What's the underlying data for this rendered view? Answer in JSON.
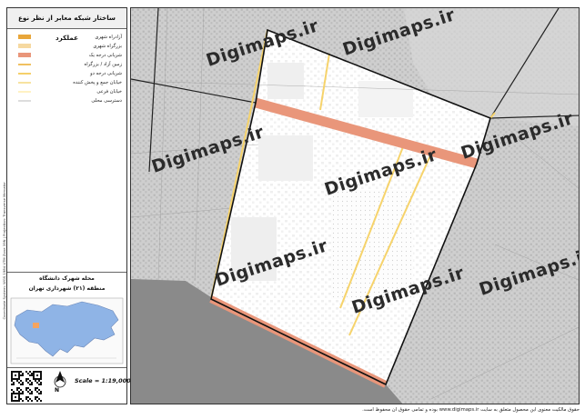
{
  "panel": {
    "title": "ساختار شبکه معابر از نظر نوع عملکرد",
    "legend": [
      {
        "label": "آزادراه شهری",
        "color": "#e8a63a",
        "kind": "fill"
      },
      {
        "label": "بزرگراه شهری",
        "color": "#f6d9a0",
        "kind": "fill"
      },
      {
        "label": "شریانی درجه یک",
        "color": "#e9967a",
        "kind": "thick"
      },
      {
        "label": "زمین آزاد / بزرگراه",
        "color": "#f0c060",
        "kind": "line"
      },
      {
        "label": "شریانی درجه دو",
        "color": "#f5d06a",
        "kind": "line"
      },
      {
        "label": "خیابان جمع و پخش کننده",
        "color": "#f7e3a0",
        "kind": "line"
      },
      {
        "label": "خیابان فرعی",
        "color": "#fff2c4",
        "kind": "line"
      },
      {
        "label": "دسترسی محلی",
        "color": "#dddddd",
        "kind": "line"
      }
    ],
    "location_title": "محله شهرک دانشگاه",
    "location_subtitle": "منطقه (۲۱) شهرداری تهران",
    "scale": "Scale = 1:19,000",
    "north_label": "N"
  },
  "watermark": "Digimaps.ir",
  "credit": "حقوق مالکیت معنوی این محصول متعلق به سایت www.digimaps.ir بوده و تمامی حقوق آن محفوظ است.",
  "side_credit": "Coordinate System: WGS 1984 UTM Zone 39N | Projection: Transverse Mercator",
  "colors": {
    "arterial": "#e9967a",
    "collector": "#f6d36b",
    "boundary": "#111111",
    "sea": "#8a8a8a",
    "city": "#8fb4e6",
    "city_border": "#6b86b6",
    "marker": "#f4a460"
  }
}
